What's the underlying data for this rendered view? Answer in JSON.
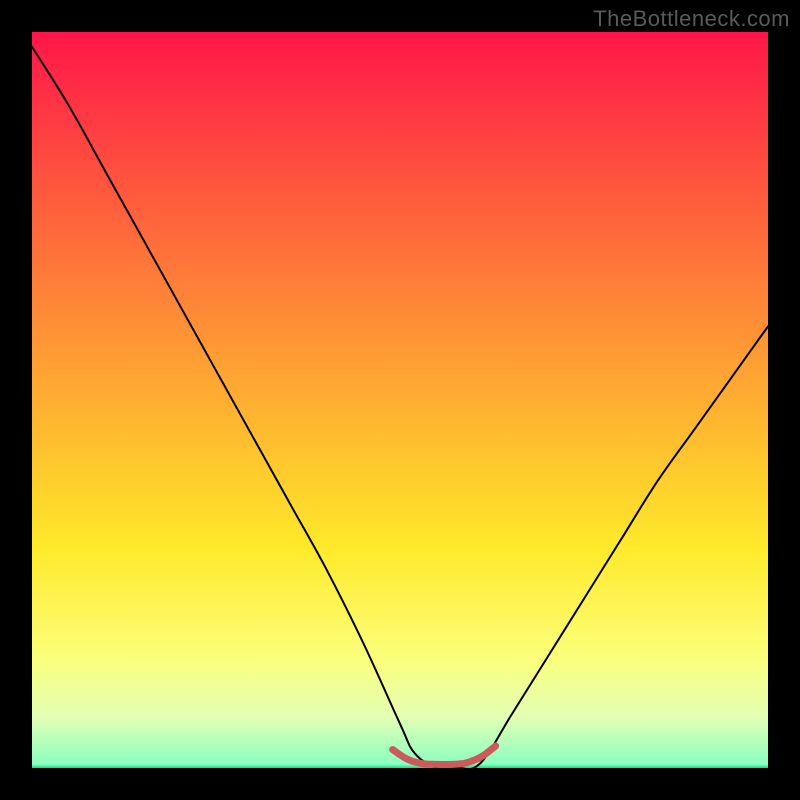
{
  "watermark": "TheBottleneck.com",
  "chart_data": {
    "type": "line",
    "title": "",
    "xlabel": "",
    "ylabel": "",
    "xlim": [
      0,
      100
    ],
    "ylim": [
      0,
      100
    ],
    "grid": false,
    "legend": false,
    "background_gradient": {
      "stops": [
        {
          "offset": 0,
          "color": "#ff1648"
        },
        {
          "offset": 0.48,
          "color": "#ffa832"
        },
        {
          "offset": 0.7,
          "color": "#ffe92a"
        },
        {
          "offset": 0.85,
          "color": "#fbff7a"
        },
        {
          "offset": 0.93,
          "color": "#e4ffb4"
        },
        {
          "offset": 0.995,
          "color": "#8affc0"
        },
        {
          "offset": 1.0,
          "color": "#00e67a"
        }
      ]
    },
    "series": [
      {
        "name": "bottleneck-curve",
        "color": "#000000",
        "width": 2,
        "x": [
          0,
          5,
          10,
          15,
          20,
          25,
          30,
          35,
          40,
          45,
          50,
          52,
          55,
          58,
          60,
          62,
          65,
          70,
          75,
          80,
          85,
          90,
          95,
          100
        ],
        "y": [
          98,
          90,
          81,
          72,
          63,
          54,
          45,
          36,
          27,
          17,
          6,
          2,
          0,
          0,
          0,
          2,
          7,
          15,
          23,
          31,
          39,
          46,
          53,
          60
        ]
      },
      {
        "name": "optimum-marker",
        "color": "#cc5a5a",
        "width": 7,
        "x": [
          49,
          51,
          53,
          55,
          57,
          59,
          61,
          63
        ],
        "y": [
          2.5,
          1.2,
          0.6,
          0.5,
          0.5,
          0.7,
          1.5,
          3
        ]
      }
    ]
  }
}
